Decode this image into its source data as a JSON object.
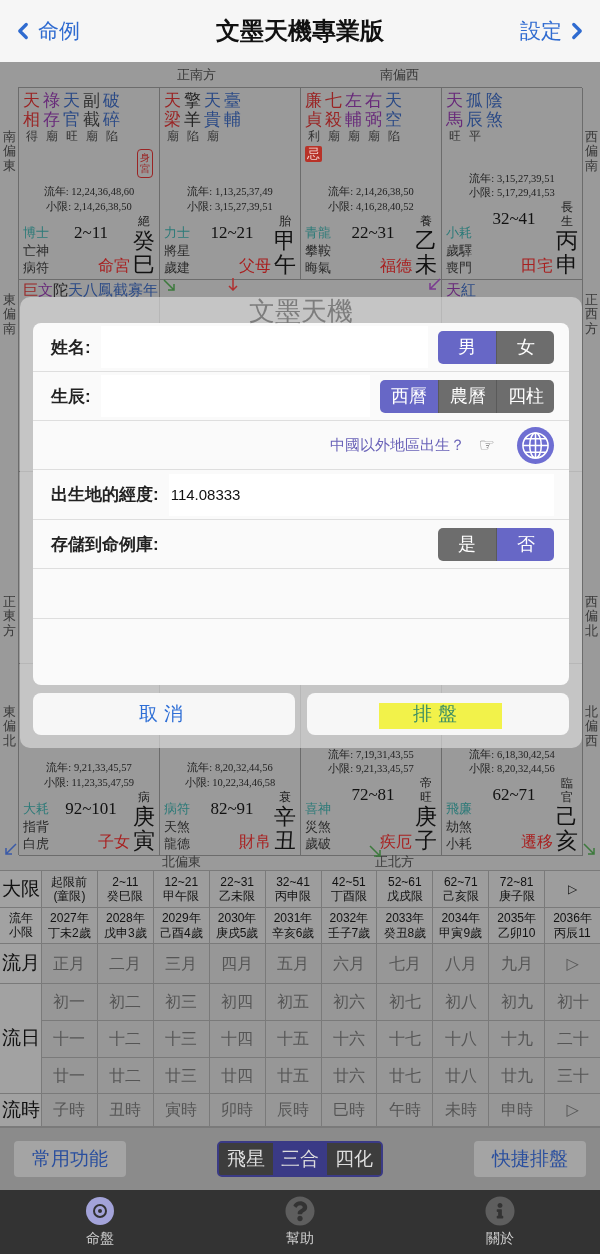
{
  "header": {
    "back": "命例",
    "title": "文墨天機專業版",
    "settings": "設定"
  },
  "chart": {
    "directions": {
      "top": [
        "正南方",
        "南偏西"
      ],
      "left": [
        "南偏東",
        "東偏南",
        "正東方",
        "東偏北"
      ],
      "right": [
        "西偏南",
        "正西方",
        "西偏北",
        "北偏西"
      ],
      "bottom": [
        "北偏東",
        "正北方"
      ]
    },
    "watermark": "文墨天機",
    "top_cells": [
      {
        "stars": [
          {
            "name": "天相",
            "brightness": "得",
            "color": "#9a2424"
          },
          {
            "name": "祿存",
            "brightness": "廟",
            "color": "#682a7a"
          },
          {
            "name": "天官",
            "brightness": "旺",
            "color": "#2b4a86"
          },
          {
            "name": "副截",
            "brightness": "廟",
            "color": "#333333"
          },
          {
            "name": "破碎",
            "brightness": "陷",
            "color": "#2b4a86"
          }
        ],
        "badge": {
          "text": "身宮",
          "kind": "outline"
        },
        "liunian": "流年: 12,24,36,48,60",
        "xiaoxian": "小限: 2,14,26,38,50",
        "gods": [
          "博士",
          "亡神",
          "病符"
        ],
        "range": "2~11",
        "stage": "絕",
        "palace": "命宮",
        "stem": "癸巳"
      },
      {
        "stars": [
          {
            "name": "天梁",
            "brightness": "廟",
            "color": "#9a2424"
          },
          {
            "name": "擎羊",
            "brightness": "陷",
            "color": "#222222"
          },
          {
            "name": "天貴",
            "brightness": "廟",
            "color": "#2b4a86"
          },
          {
            "name": "臺輔",
            "color": "#2b4a86"
          }
        ],
        "liunian": "流年: 1,13,25,37,49",
        "xiaoxian": "小限: 3,15,27,39,51",
        "gods": [
          "力士",
          "將星",
          "歲建"
        ],
        "range": "12~21",
        "stage": "胎",
        "palace": "父母",
        "stem": "甲午"
      },
      {
        "stars": [
          {
            "name": "廉貞",
            "brightness": "利",
            "color": "#9a2424"
          },
          {
            "name": "七殺",
            "brightness": "廟",
            "color": "#9a2424"
          },
          {
            "name": "左輔",
            "brightness": "廟",
            "color": "#682a7a"
          },
          {
            "name": "右弼",
            "brightness": "廟",
            "color": "#682a7a"
          },
          {
            "name": "天空",
            "brightness": "陷",
            "color": "#2b4a86"
          }
        ],
        "badge": {
          "text": "忌",
          "kind": "filled"
        },
        "liunian": "流年: 2,14,26,38,50",
        "xiaoxian": "小限: 4,16,28,40,52",
        "gods": [
          "青龍",
          "攀鞍",
          "晦氣"
        ],
        "range": "22~31",
        "stage": "養",
        "palace": "福德",
        "stem": "乙未"
      },
      {
        "stars": [
          {
            "name": "天馬",
            "brightness": "旺",
            "color": "#682a7a"
          },
          {
            "name": "孤辰",
            "brightness": "平",
            "color": "#2b4a86"
          },
          {
            "name": "陰煞",
            "color": "#2b4a86"
          }
        ],
        "liunian": "流年: 3,15,27,39,51",
        "xiaoxian": "小限: 5,17,29,41,53",
        "gods": [
          "小耗",
          "歲驛",
          "喪門"
        ],
        "range": "32~41",
        "stage": "長生",
        "palace": "田宅",
        "stem": "丙申"
      }
    ],
    "middle_cells": [
      {
        "stars": [
          {
            "name": "巨",
            "color": "#9a2424"
          },
          {
            "name": "文",
            "color": "#682a7a"
          },
          {
            "name": "陀",
            "color": "#222222"
          },
          {
            "name": "天",
            "color": "#2b4a86"
          },
          {
            "name": "八",
            "color": "#2b4a86"
          },
          {
            "name": "鳳",
            "color": "#2b4a86"
          },
          {
            "name": "截",
            "color": "#2b4a86"
          },
          {
            "name": "寡",
            "color": "#2b4a86"
          },
          {
            "name": "年",
            "color": "#2b4a86"
          }
        ]
      },
      {
        "stars": [
          {
            "name": "天",
            "color": "#682a7a"
          },
          {
            "name": "紅",
            "color": "#2b4a86"
          }
        ]
      }
    ],
    "bottom_cells": [
      {
        "liunian": "流年: 9,21,33,45,57",
        "xiaoxian": "小限: 11,23,35,47,59",
        "gods": [
          "大耗",
          "指背",
          "白虎"
        ],
        "range": "92~101",
        "stage": "病",
        "palace": "子女",
        "stem": "庚寅"
      },
      {
        "liunian": "流年: 8,20,32,44,56",
        "xiaoxian": "小限: 10,22,34,46,58",
        "gods": [
          "病符",
          "天煞",
          "龍德"
        ],
        "range": "82~91",
        "stage": "衰",
        "palace": "財帛",
        "stem": "辛丑"
      },
      {
        "liunian": "流年: 7,19,31,43,55",
        "xiaoxian": "小限: 9,21,33,45,57",
        "gods": [
          "喜神",
          "災煞",
          "歲破"
        ],
        "range": "72~81",
        "stage": "帝旺",
        "palace": "疾厄",
        "stem": "庚子"
      },
      {
        "liunian": "流年: 6,18,30,42,54",
        "xiaoxian": "小限: 8,20,32,44,56",
        "gods": [
          "飛廉",
          "劫煞",
          "小耗"
        ],
        "range": "62~71",
        "stage": "臨官",
        "palace": "遷移",
        "stem": "己亥"
      }
    ]
  },
  "modal": {
    "name_label": "姓名:",
    "gender": [
      {
        "label": "男",
        "selected": true
      },
      {
        "label": "女",
        "selected": false
      }
    ],
    "birth_label": "生辰:",
    "calendar": [
      {
        "label": "西曆",
        "selected": true
      },
      {
        "label": "農曆",
        "selected": false
      },
      {
        "label": "四柱",
        "selected": false
      }
    ],
    "abroad_link": "中國以外地區出生？",
    "pointer": "☞",
    "longitude_label": "出生地的經度:",
    "longitude_value": "114.08333",
    "save_label": "存儲到命例庫:",
    "save": [
      {
        "label": "是",
        "selected": false
      },
      {
        "label": "否",
        "selected": true
      }
    ],
    "cancel": "取消",
    "confirm": {
      "label": "排盤",
      "highlighted": true
    }
  },
  "table": {
    "rows": [
      {
        "kind": "major",
        "label": [
          "大限"
        ],
        "cell_rows": [
          [
            [
              "起限前",
              "(童限)"
            ],
            [
              "2~11",
              "癸巳限"
            ],
            [
              "12~21",
              "甲午限"
            ],
            [
              "22~31",
              "乙未限"
            ],
            [
              "32~41",
              "丙申限"
            ],
            [
              "42~51",
              "丁酉限"
            ],
            [
              "52~61",
              "戊戌限"
            ],
            [
              "62~71",
              "己亥限"
            ],
            [
              "72~81",
              "庚子限"
            ],
            [
              "▷"
            ]
          ]
        ]
      },
      {
        "kind": "major",
        "label": [
          "流年",
          "小限"
        ],
        "cell_rows": [
          [
            [
              "2027年",
              "丁未2歲"
            ],
            [
              "2028年",
              "戊申3歲"
            ],
            [
              "2029年",
              "己酉4歲"
            ],
            [
              "2030年",
              "庚戌5歲"
            ],
            [
              "2031年",
              "辛亥6歲"
            ],
            [
              "2032年",
              "壬子7歲"
            ],
            [
              "2033年",
              "癸丑8歲"
            ],
            [
              "2034年",
              "甲寅9歲"
            ],
            [
              "2035年",
              "乙卯10"
            ],
            [
              "2036年",
              "丙辰11"
            ]
          ]
        ]
      },
      {
        "kind": "minor",
        "label": [
          "流月"
        ],
        "cell_rows": [
          [
            [
              "正月"
            ],
            [
              "二月"
            ],
            [
              "三月"
            ],
            [
              "四月"
            ],
            [
              "五月"
            ],
            [
              "六月"
            ],
            [
              "七月"
            ],
            [
              "八月"
            ],
            [
              "九月"
            ],
            [
              "▷"
            ]
          ]
        ]
      },
      {
        "kind": "minor",
        "label": [
          "流日"
        ],
        "cell_rows": [
          [
            [
              "初一"
            ],
            [
              "初二"
            ],
            [
              "初三"
            ],
            [
              "初四"
            ],
            [
              "初五"
            ],
            [
              "初六"
            ],
            [
              "初七"
            ],
            [
              "初八"
            ],
            [
              "初九"
            ],
            [
              "初十"
            ]
          ],
          [
            [
              "十一"
            ],
            [
              "十二"
            ],
            [
              "十三"
            ],
            [
              "十四"
            ],
            [
              "十五"
            ],
            [
              "十六"
            ],
            [
              "十七"
            ],
            [
              "十八"
            ],
            [
              "十九"
            ],
            [
              "二十"
            ]
          ],
          [
            [
              "廿一"
            ],
            [
              "廿二"
            ],
            [
              "廿三"
            ],
            [
              "廿四"
            ],
            [
              "廿五"
            ],
            [
              "廿六"
            ],
            [
              "廿七"
            ],
            [
              "廿八"
            ],
            [
              "廿九"
            ],
            [
              "三十"
            ]
          ]
        ]
      },
      {
        "kind": "minor",
        "label": [
          "流時"
        ],
        "cell_rows": [
          [
            [
              "子時"
            ],
            [
              "丑時"
            ],
            [
              "寅時"
            ],
            [
              "卯時"
            ],
            [
              "辰時"
            ],
            [
              "巳時"
            ],
            [
              "午時"
            ],
            [
              "未時"
            ],
            [
              "申時"
            ],
            [
              "▷"
            ]
          ]
        ]
      }
    ]
  },
  "toolbar": {
    "left_button": "常用功能",
    "modes": [
      {
        "label": "飛星",
        "selected": false
      },
      {
        "label": "三合",
        "selected": true
      },
      {
        "label": "四化",
        "selected": false
      }
    ],
    "right_button": "快捷排盤"
  },
  "tab_bar": [
    {
      "kind": "chart",
      "label": "命盤",
      "selected": true
    },
    {
      "kind": "help",
      "label": "幫助",
      "selected": false
    },
    {
      "kind": "info",
      "label": "關於",
      "selected": false
    }
  ]
}
